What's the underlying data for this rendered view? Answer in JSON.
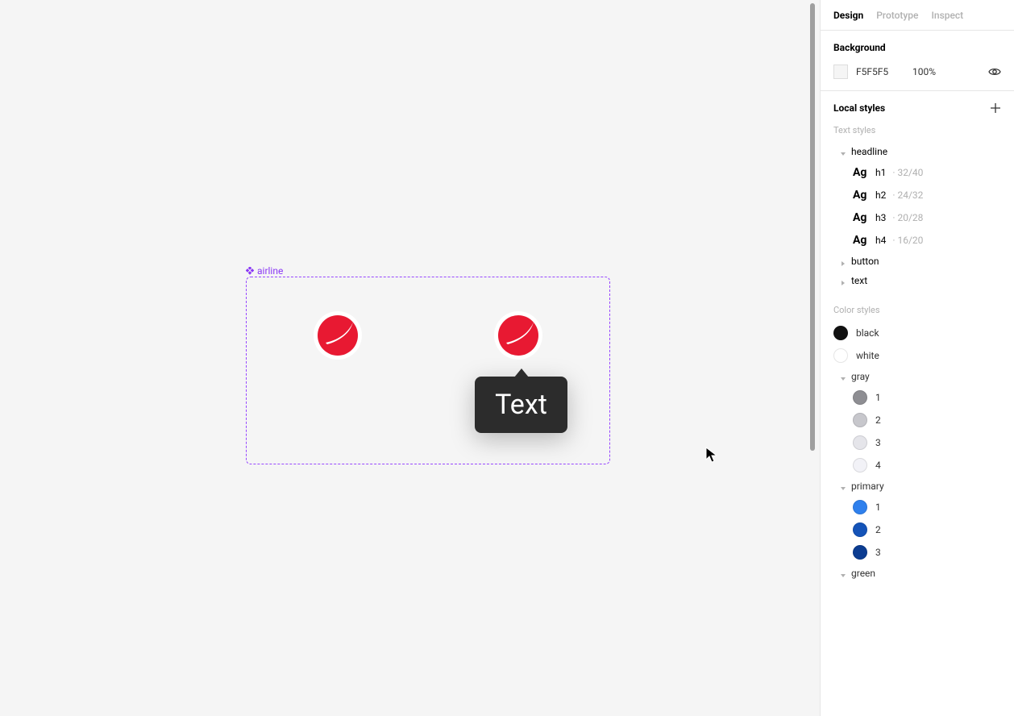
{
  "canvas": {
    "component_label": "airline",
    "tooltip_text": "Text"
  },
  "panel": {
    "tabs": {
      "design": "Design",
      "prototype": "Prototype",
      "inspect": "Inspect"
    },
    "background": {
      "title": "Background",
      "hex": "F5F5F5",
      "opacity": "100%"
    },
    "local_styles": {
      "title": "Local styles",
      "text_header": "Text styles",
      "color_header": "Color styles",
      "text_groups": {
        "headline": {
          "label": "headline",
          "items": [
            {
              "ag": "Ag",
              "name": "h1",
              "meta": "· 32/40"
            },
            {
              "ag": "Ag",
              "name": "h2",
              "meta": "· 24/32"
            },
            {
              "ag": "Ag",
              "name": "h3",
              "meta": "· 20/28"
            },
            {
              "ag": "Ag",
              "name": "h4",
              "meta": "· 16/20"
            }
          ]
        },
        "button": {
          "label": "button"
        },
        "text": {
          "label": "text"
        }
      },
      "color_items": {
        "black": {
          "label": "black",
          "color": "#111111"
        },
        "white": {
          "label": "white",
          "color": "#FFFFFF"
        },
        "gray": {
          "label": "gray",
          "items": [
            {
              "label": "1",
              "color": "#8E8E93"
            },
            {
              "label": "2",
              "color": "#C7C7CC"
            },
            {
              "label": "3",
              "color": "#E5E5EA"
            },
            {
              "label": "4",
              "color": "#F2F2F7"
            }
          ]
        },
        "primary": {
          "label": "primary",
          "items": [
            {
              "label": "1",
              "color": "#2F80ED"
            },
            {
              "label": "2",
              "color": "#1453B8"
            },
            {
              "label": "3",
              "color": "#0B3C91"
            }
          ]
        },
        "green": {
          "label": "green"
        }
      }
    }
  }
}
